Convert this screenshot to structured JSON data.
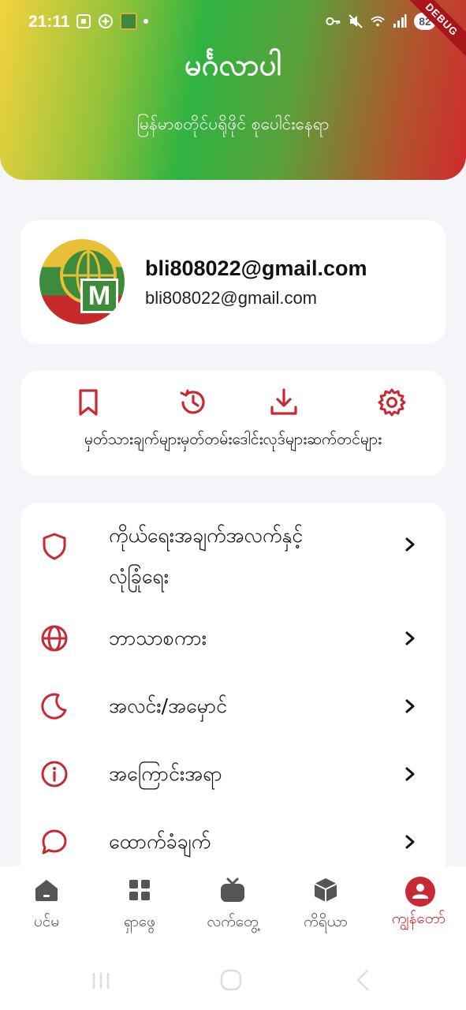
{
  "status_bar": {
    "time": "21:11",
    "battery": "82",
    "debug_label": "DEBUG",
    "left_icons": [
      "screenshot-icon",
      "pinwheel-icon",
      "app-icon",
      "dot-icon"
    ],
    "right_icons": [
      "key-icon",
      "mute-icon",
      "wifi-icon",
      "signal-icon",
      "battery-icon"
    ]
  },
  "header": {
    "title": "မင်္ဂလာပါ",
    "subtitle": "မြန်မာစတိုင်ပရိုဖိုင် စုပေါင်းနေရာ"
  },
  "profile": {
    "name": "bli808022@gmail.com",
    "email": "bli808022@gmail.com",
    "avatar_letter": "M"
  },
  "actions": {
    "items": [
      {
        "icon": "bookmark-icon",
        "label": "မှတ်သားချက်များ"
      },
      {
        "icon": "history-icon",
        "label": "မှတ်တမ်း"
      },
      {
        "icon": "download-icon",
        "label": "ဒေါင်းလုဒ်များ"
      },
      {
        "icon": "gear-icon",
        "label": "ဆက်တင်များ"
      }
    ]
  },
  "menu": {
    "items": [
      {
        "icon": "shield-icon",
        "label_line1": "ကိုယ်ရေးအချက်အလက်နှင့်",
        "label_line2": "လုံခြုံရေး"
      },
      {
        "icon": "globe-icon",
        "label": "ဘာသာစကား"
      },
      {
        "icon": "moon-icon",
        "label": "အလင်း/အမှောင်"
      },
      {
        "icon": "info-icon",
        "label": "အကြောင်းအရာ"
      },
      {
        "icon": "chat-icon",
        "label": "ထောက်ခံချက်"
      }
    ]
  },
  "bottom_nav": {
    "items": [
      {
        "icon": "home-icon",
        "label": "ပင်မ"
      },
      {
        "icon": "grid-icon",
        "label": "ရှာဖွေ"
      },
      {
        "icon": "tv-icon",
        "label": "လက်တွေ့"
      },
      {
        "icon": "box-icon",
        "label": "ကိရိယာ"
      },
      {
        "icon": "profile-icon",
        "label": "ကျွန်တော်"
      }
    ],
    "active_index": 4
  },
  "colors": {
    "accent": "#c62a35",
    "nav_inactive": "#555555"
  }
}
